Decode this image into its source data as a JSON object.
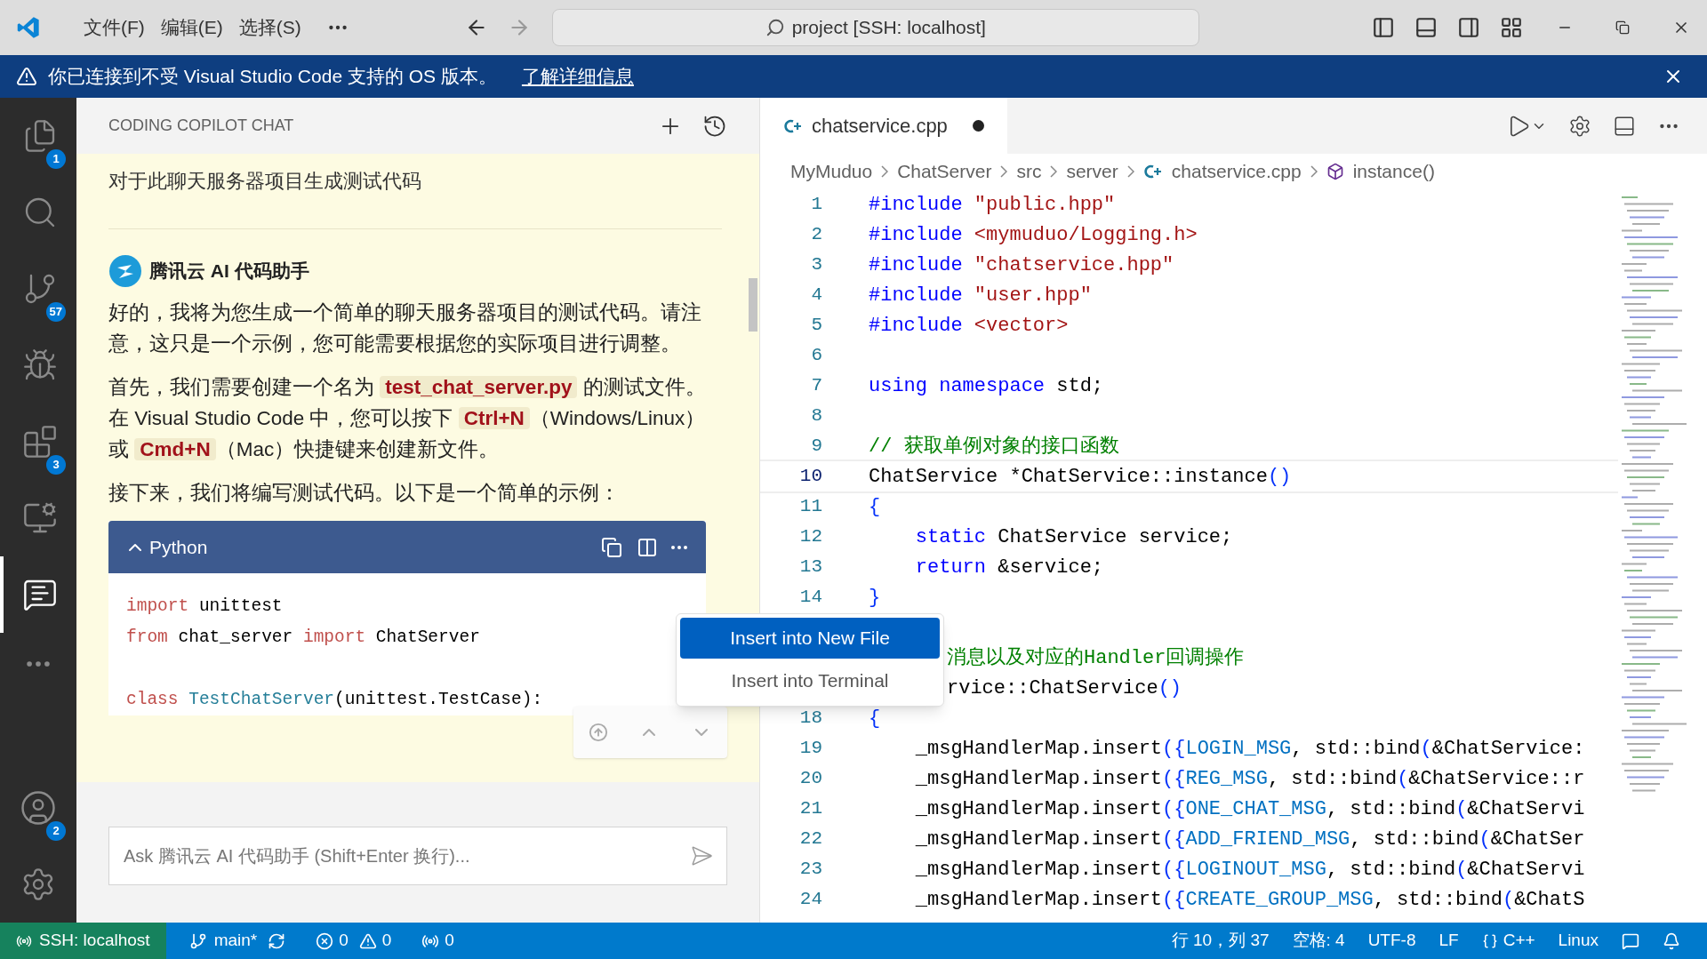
{
  "title_bar": {
    "menus": [
      {
        "label": "文件(F)"
      },
      {
        "label": "编辑(E)"
      },
      {
        "label": "选择(S)"
      }
    ],
    "search": "project [SSH: localhost]"
  },
  "banner": {
    "message": "你已连接到不受 Visual Studio Code 支持的 OS 版本。",
    "link": "了解详细信息"
  },
  "activity_bar": {
    "items": [
      {
        "kind": "explorer",
        "badge": "1",
        "selected": false
      },
      {
        "kind": "search",
        "selected": false
      },
      {
        "kind": "source-control",
        "badge": "57",
        "selected": false
      },
      {
        "kind": "run",
        "selected": false
      },
      {
        "kind": "extensions",
        "badge": "3",
        "selected": false
      },
      {
        "kind": "remote",
        "selected": false
      },
      {
        "kind": "chat",
        "selected": true
      }
    ],
    "accounts_badge": "2"
  },
  "chat": {
    "title": "CODING COPILOT CHAT",
    "user_message": "对于此聊天服务器项目生成测试代码",
    "assistant": "腾讯云 AI 代码助手",
    "paragraphs": [
      [
        {
          "text": "好的，我将为您生成一个简单的聊天服务器项目的测试代码。请注意，这只是一个示例，您可能需要根据您的实际项目进行调整。",
          "code": false
        }
      ],
      [
        {
          "text": "首先，我们需要创建一个名为 ",
          "code": false
        },
        {
          "text": "test_chat_server.py",
          "code": true
        },
        {
          "text": " 的测试文件。在 Visual Studio Code 中，您可以按下 ",
          "code": false
        },
        {
          "text": "Ctrl+N",
          "code": true
        },
        {
          "text": "（Windows/Linux）或 ",
          "code": false
        },
        {
          "text": "Cmd+N",
          "code": true
        },
        {
          "text": "（Mac）快捷键来创建新文件。",
          "code": false
        }
      ],
      [
        {
          "text": "接下来，我们将编写测试代码。以下是一个简单的示例：",
          "code": false
        }
      ]
    ],
    "code_block": {
      "language": "Python",
      "expanded": true,
      "lines": [
        {
          "kind": "code",
          "segments": [
            {
              "text": "import",
              "kind": "pykw"
            },
            {
              "text": " unittest",
              "kind": "plain"
            }
          ]
        },
        {
          "kind": "code",
          "segments": [
            {
              "text": "from",
              "kind": "pykw"
            },
            {
              "text": " chat_server ",
              "kind": "plain"
            },
            {
              "text": "import",
              "kind": "pykw"
            },
            {
              "text": " ChatServer",
              "kind": "plain"
            }
          ]
        },
        {
          "kind": "blank"
        },
        {
          "kind": "code",
          "segments": [
            {
              "text": "class ",
              "kind": "pykw"
            },
            {
              "text": "TestChatServer",
              "kind": "pyclass"
            },
            {
              "text": "(unittest.TestCase):",
              "kind": "plain"
            }
          ]
        }
      ]
    },
    "menu": [
      {
        "label": "Insert into New File",
        "selected": true
      },
      {
        "label": "Insert into Terminal",
        "selected": false
      }
    ],
    "input": {
      "placeholder": "Ask 腾讯云 AI 代码助手 (Shift+Enter 换行)..."
    }
  },
  "editor": {
    "tab": {
      "name": "chatservice.cpp",
      "modified": true
    },
    "breadcrumbs": [
      {
        "label": "MyMuduo",
        "kind": "folder"
      },
      {
        "label": "ChatServer",
        "kind": "folder"
      },
      {
        "label": "src",
        "kind": "folder"
      },
      {
        "label": "server",
        "kind": "folder"
      },
      {
        "label": "chatservice.cpp",
        "kind": "file"
      },
      {
        "label": "instance()",
        "kind": "symbol"
      }
    ],
    "lines": [
      {
        "number": "1",
        "current": false,
        "segments": [
          {
            "text": "#include ",
            "kind": "keyword"
          },
          {
            "text": "\"public.hpp\"",
            "kind": "string"
          }
        ]
      },
      {
        "number": "2",
        "current": false,
        "segments": [
          {
            "text": "#include ",
            "kind": "keyword"
          },
          {
            "text": "<mymuduo/Logging.h>",
            "kind": "string"
          }
        ]
      },
      {
        "number": "3",
        "current": false,
        "segments": [
          {
            "text": "#include ",
            "kind": "keyword"
          },
          {
            "text": "\"chatservice.hpp\"",
            "kind": "string"
          }
        ]
      },
      {
        "number": "4",
        "current": false,
        "segments": [
          {
            "text": "#include ",
            "kind": "keyword"
          },
          {
            "text": "\"user.hpp\"",
            "kind": "string"
          }
        ]
      },
      {
        "number": "5",
        "current": false,
        "segments": [
          {
            "text": "#include ",
            "kind": "keyword"
          },
          {
            "text": "<vector>",
            "kind": "string"
          }
        ]
      },
      {
        "number": "6",
        "current": false
      },
      {
        "number": "7",
        "current": false,
        "segments": [
          {
            "text": "using namespace ",
            "kind": "keyword"
          },
          {
            "text": "std;",
            "kind": "plain"
          }
        ]
      },
      {
        "number": "8",
        "current": false
      },
      {
        "number": "9",
        "current": false,
        "segments": [
          {
            "text": "// 获取单例对象的接口函数",
            "kind": "comment"
          }
        ]
      },
      {
        "number": "10",
        "current": true,
        "segments": [
          {
            "text": "ChatService *ChatService::instance",
            "kind": "plain"
          },
          {
            "text": "()",
            "kind": "paren"
          }
        ]
      },
      {
        "number": "11",
        "current": false,
        "segments": [
          {
            "text": "{",
            "kind": "paren"
          }
        ]
      },
      {
        "number": "12",
        "current": false,
        "segments": [
          {
            "text": "    static ",
            "kind": "keyword"
          },
          {
            "text": "ChatService service;",
            "kind": "plain"
          }
        ]
      },
      {
        "number": "13",
        "current": false,
        "segments": [
          {
            "text": "    return ",
            "kind": "keyword"
          },
          {
            "text": "&service;",
            "kind": "plain"
          }
        ]
      },
      {
        "number": "14",
        "current": false,
        "segments": [
          {
            "text": "}",
            "kind": "paren"
          }
        ]
      },
      {
        "current": false,
        "segments": [
          {
            "text": "消息以及对应的Handler回调操作",
            "kind": "comment"
          }
        ]
      },
      {
        "current": false,
        "segments": [
          {
            "text": "rvice::ChatService",
            "kind": "plain"
          },
          {
            "text": "()",
            "kind": "paren"
          }
        ]
      },
      {
        "number": "18",
        "current": false,
        "segments": [
          {
            "text": "{",
            "kind": "paren"
          }
        ]
      },
      {
        "number": "19",
        "current": false,
        "segments": [
          {
            "text": "    _msgHandlerMap.insert",
            "kind": "plain"
          },
          {
            "text": "({",
            "kind": "paren"
          },
          {
            "text": "LOGIN_MSG",
            "kind": "macro"
          },
          {
            "text": ", std::bind",
            "kind": "plain"
          },
          {
            "text": "(",
            "kind": "paren"
          },
          {
            "text": "&ChatService:",
            "kind": "plain"
          }
        ]
      },
      {
        "number": "20",
        "current": false,
        "segments": [
          {
            "text": "    _msgHandlerMap.insert",
            "kind": "plain"
          },
          {
            "text": "({",
            "kind": "paren"
          },
          {
            "text": "REG_MSG",
            "kind": "macro"
          },
          {
            "text": ", std::bind",
            "kind": "plain"
          },
          {
            "text": "(",
            "kind": "paren"
          },
          {
            "text": "&ChatService::r",
            "kind": "plain"
          }
        ]
      },
      {
        "number": "21",
        "current": false,
        "segments": [
          {
            "text": "    _msgHandlerMap.insert",
            "kind": "plain"
          },
          {
            "text": "({",
            "kind": "paren"
          },
          {
            "text": "ONE_CHAT_MSG",
            "kind": "macro"
          },
          {
            "text": ", std::bind",
            "kind": "plain"
          },
          {
            "text": "(",
            "kind": "paren"
          },
          {
            "text": "&ChatServi",
            "kind": "plain"
          }
        ]
      },
      {
        "number": "22",
        "current": false,
        "segments": [
          {
            "text": "    _msgHandlerMap.insert",
            "kind": "plain"
          },
          {
            "text": "({",
            "kind": "paren"
          },
          {
            "text": "ADD_FRIEND_MSG",
            "kind": "macro"
          },
          {
            "text": ", std::bind",
            "kind": "plain"
          },
          {
            "text": "(",
            "kind": "paren"
          },
          {
            "text": "&ChatSer",
            "kind": "plain"
          }
        ]
      },
      {
        "number": "23",
        "current": false,
        "segments": [
          {
            "text": "    _msgHandlerMap.insert",
            "kind": "plain"
          },
          {
            "text": "({",
            "kind": "paren"
          },
          {
            "text": "LOGINOUT_MSG",
            "kind": "macro"
          },
          {
            "text": ", std::bind",
            "kind": "plain"
          },
          {
            "text": "(",
            "kind": "paren"
          },
          {
            "text": "&ChatServi",
            "kind": "plain"
          }
        ]
      },
      {
        "number": "24",
        "current": false,
        "segments": [
          {
            "text": "    _msgHandlerMap.insert",
            "kind": "plain"
          },
          {
            "text": "({",
            "kind": "paren"
          },
          {
            "text": "CREATE_GROUP_MSG",
            "kind": "macro"
          },
          {
            "text": ", std::bind",
            "kind": "plain"
          },
          {
            "text": "(",
            "kind": "paren"
          },
          {
            "text": "&ChatS",
            "kind": "plain"
          }
        ]
      }
    ]
  },
  "status_bar": {
    "remote": "SSH: localhost",
    "branch": "main*",
    "errors": "0",
    "warnings": "0",
    "ports": "0",
    "position": "行 10，列 37",
    "indent": "空格: 4",
    "encoding": "UTF-8",
    "eol": "LF",
    "language": "C++",
    "platform": "Linux"
  }
}
